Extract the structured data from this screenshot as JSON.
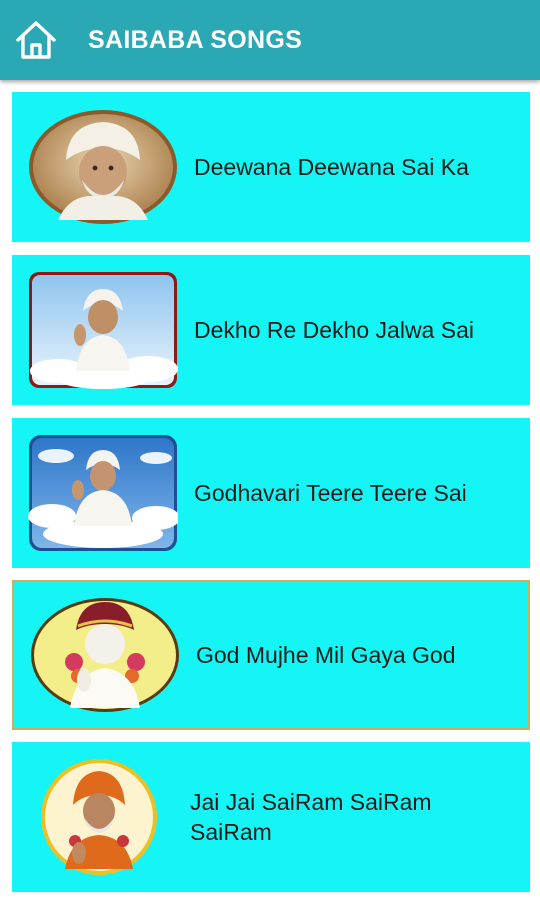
{
  "app": {
    "title": "SAIBABA SONGS",
    "header_color": "#2aa8b4",
    "card_color": "#16f5f5",
    "home_icon": "home-icon"
  },
  "songs": [
    {
      "title": "Deewana Deewana Sai Ka",
      "thumbnail": "portrait-oval-icon",
      "selected": false
    },
    {
      "title": "Dekho Re Dekho Jalwa Sai",
      "thumbnail": "portrait-clouds-frame-icon",
      "selected": false
    },
    {
      "title": "Godhavari Teere Teere Sai",
      "thumbnail": "portrait-sky-clouds-icon",
      "selected": false
    },
    {
      "title": "God Mujhe Mil Gaya God",
      "thumbnail": "portrait-garland-oval-icon",
      "selected": true
    },
    {
      "title": "Jai Jai SaiRam SaiRam SaiRam",
      "thumbnail": "portrait-orange-round-icon",
      "selected": false
    }
  ]
}
